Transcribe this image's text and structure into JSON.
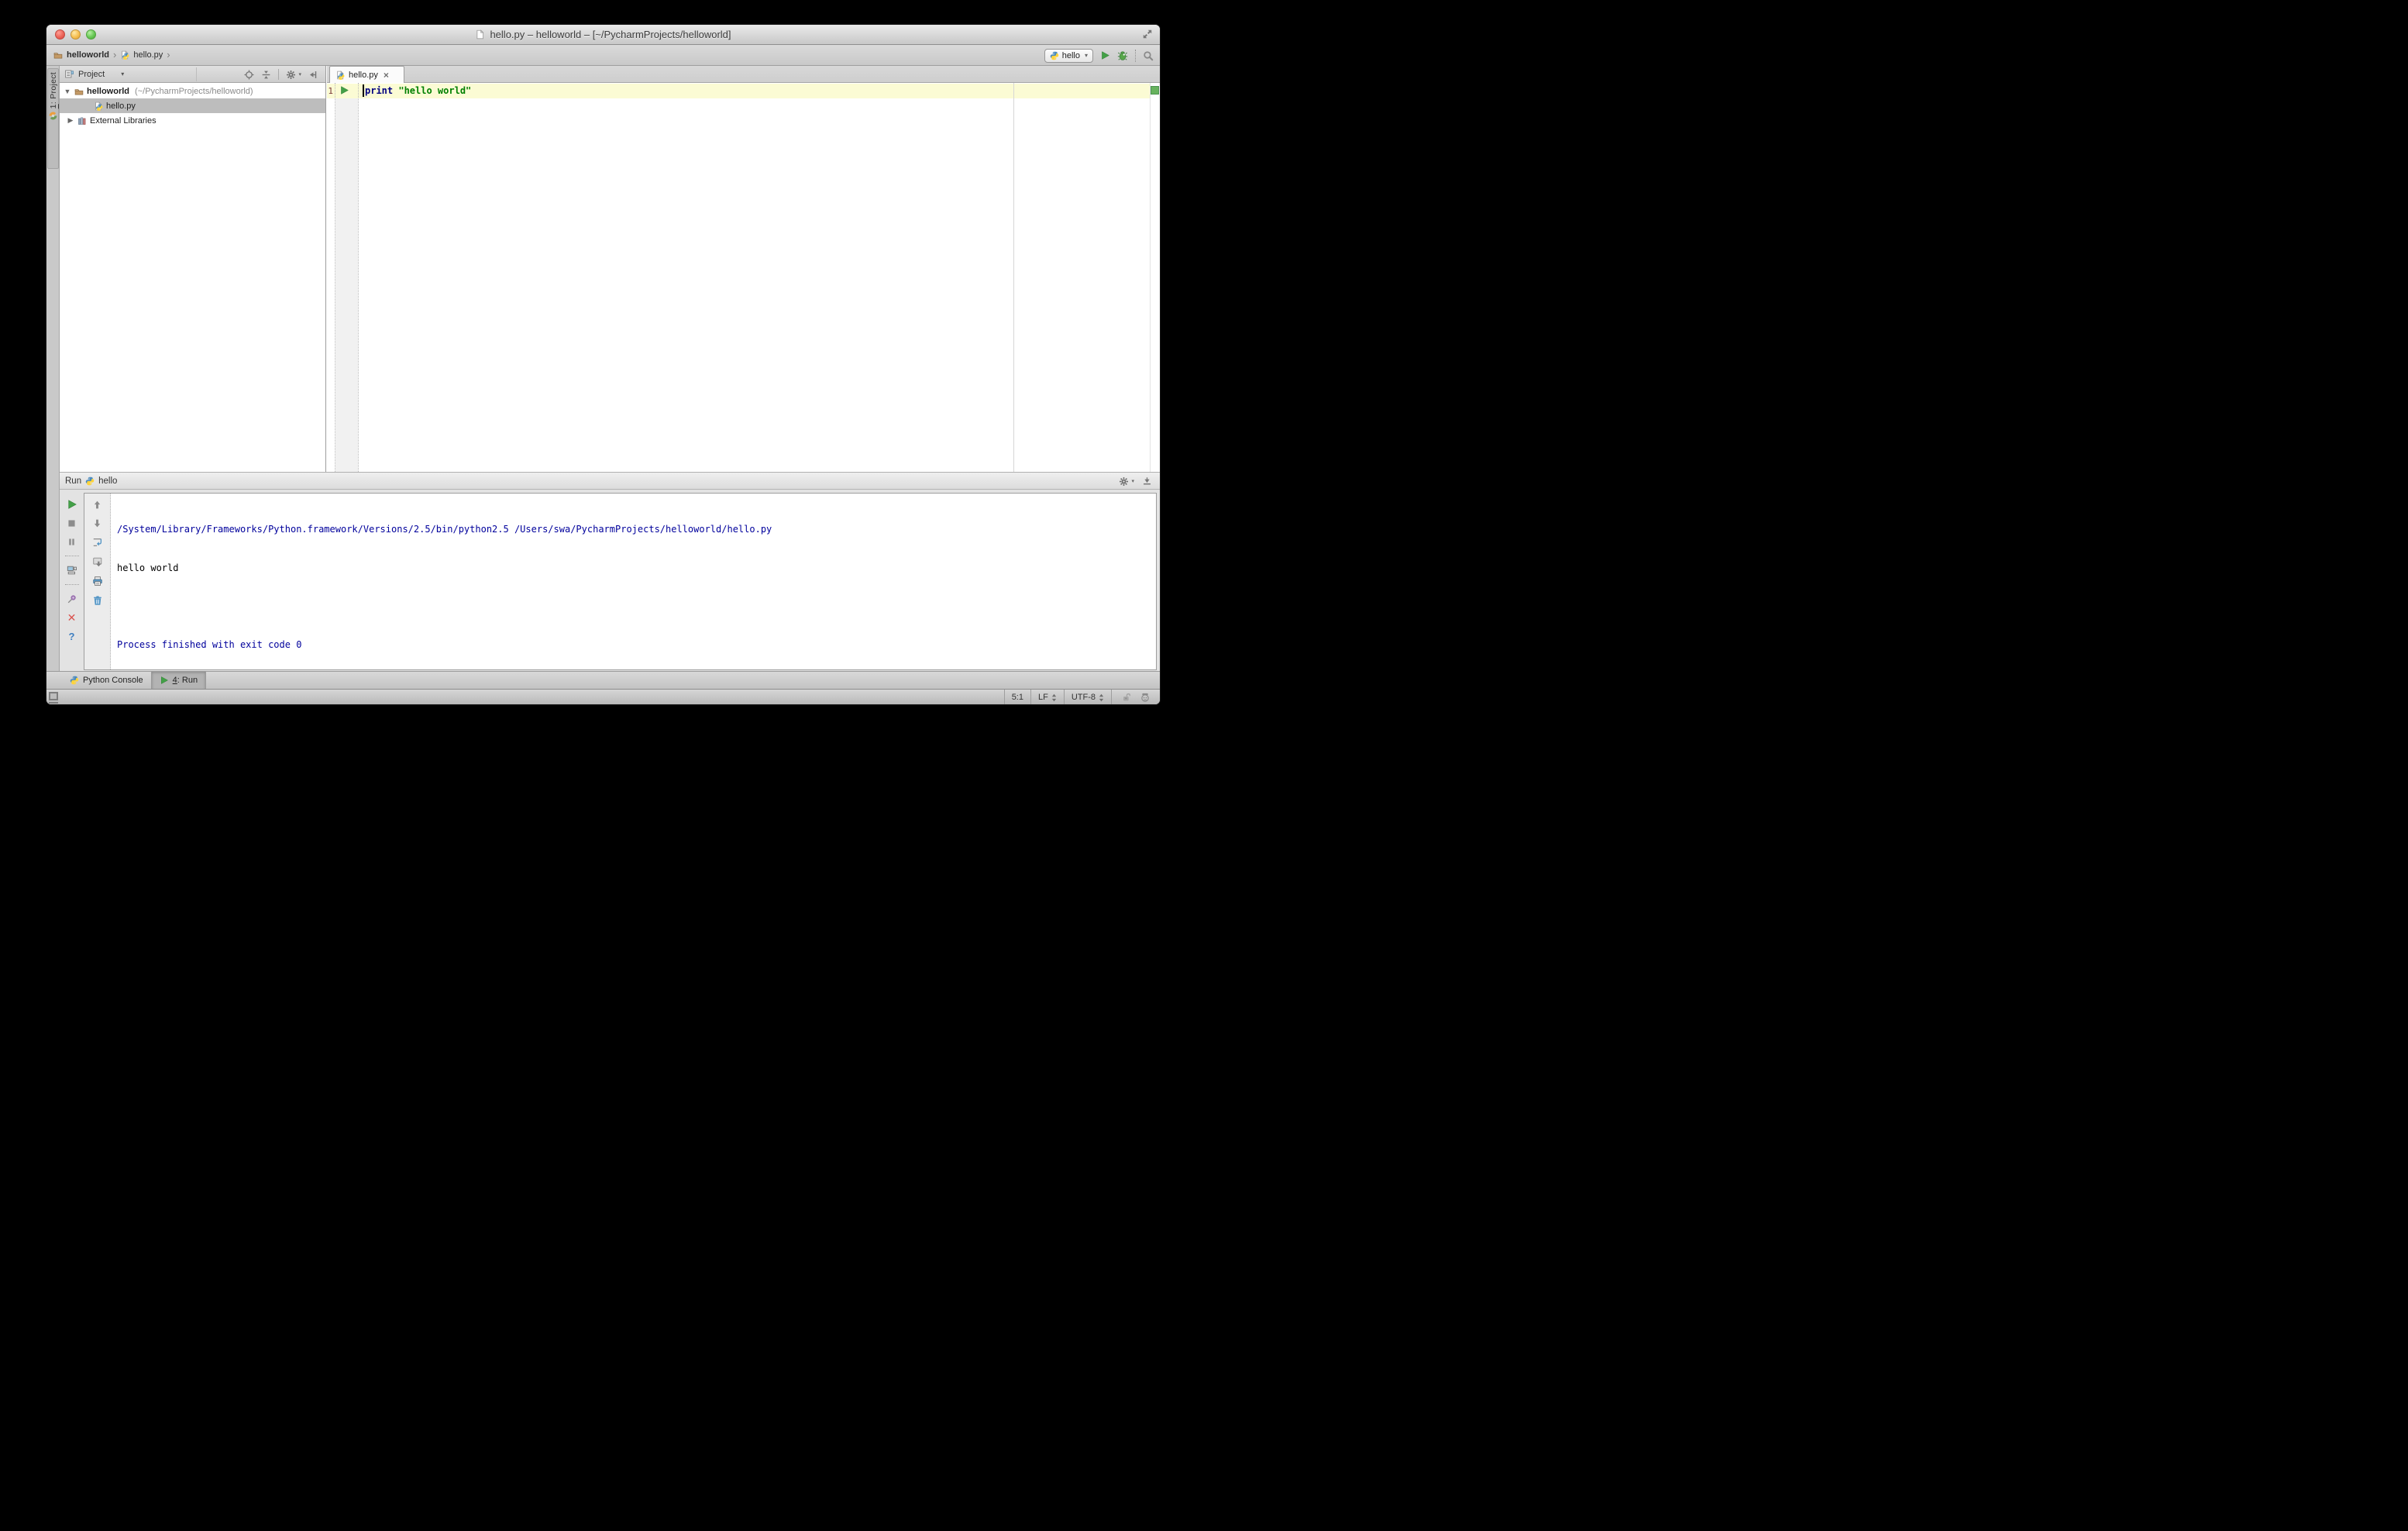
{
  "window": {
    "title": "hello.py – helloworld – [~/PycharmProjects/helloworld]"
  },
  "navbar": {
    "breadcrumbs": [
      {
        "label": "helloworld"
      },
      {
        "label": "hello.py"
      }
    ],
    "separator": "›",
    "run_config": "hello"
  },
  "tool_window_bar": {
    "project_tab_num": "1",
    "project_tab_rest": ": Project"
  },
  "project_panel": {
    "header_label": "Project",
    "tree": [
      {
        "name": "helloworld",
        "path_suffix": " (~/PycharmProjects/helloworld)"
      },
      {
        "name": "hello.py"
      },
      {
        "name": "External Libraries"
      }
    ]
  },
  "editor": {
    "tab_label": "hello.py",
    "close_glyph": "×",
    "line1": {
      "number": "1",
      "keyword": "print",
      "string": " \"hello world\""
    }
  },
  "run_panel": {
    "label": "Run",
    "config_name": "hello",
    "console": [
      {
        "text": "/System/Library/Frameworks/Python.framework/Versions/2.5/bin/python2.5 /Users/swa/PycharmProjects/helloworld/hello.py"
      },
      {
        "text": "hello world"
      },
      {
        "text": ""
      },
      {
        "text": "Process finished with exit code 0"
      }
    ]
  },
  "bottom_bar": {
    "python_console_label": "Python Console",
    "run_tab_num": "4",
    "run_tab_rest": ": Run"
  },
  "status_bar": {
    "caret_position": "5:1",
    "line_separator": "LF",
    "encoding": "UTF-8"
  },
  "colors": {
    "accent_green": "#43a047",
    "keyword_blue": "#000080",
    "string_green": "#008000",
    "console_blue": "#00009c",
    "caret_line": "#fbfbd4",
    "selection_gray": "#bdbdbd",
    "ok_indicator": "#67b25d"
  }
}
